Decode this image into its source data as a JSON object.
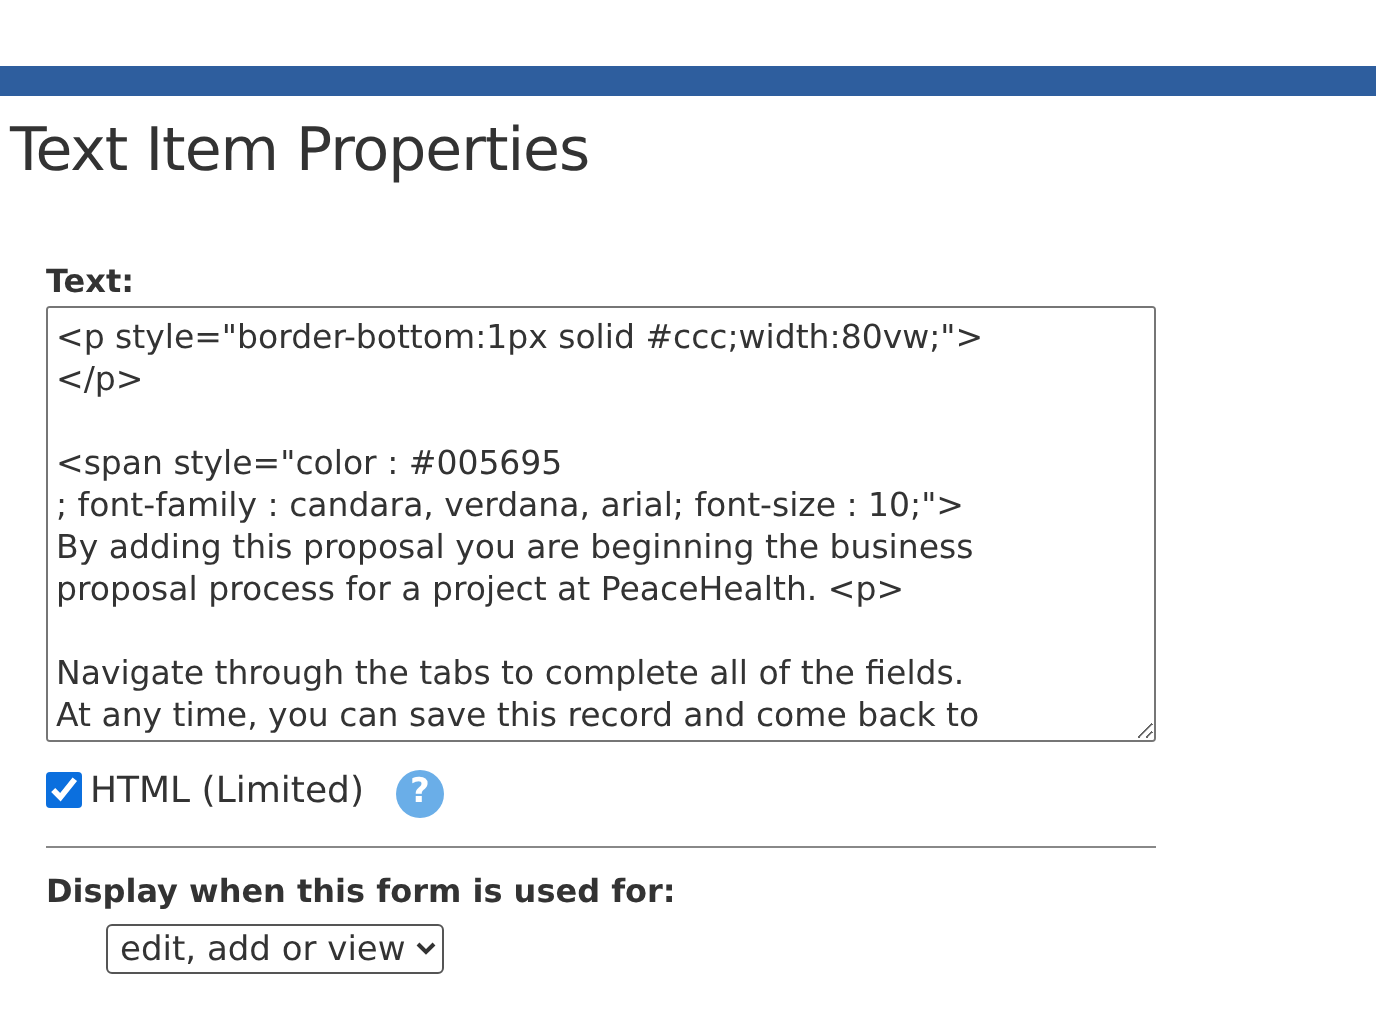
{
  "title": "Text Item Properties",
  "text_field": {
    "label": "Text:",
    "value": "<p style=\"border-bottom:1px solid #ccc;width:80vw;\">\n</p>\n\n<span style=\"color : #005695\n; font-family : candara, verdana, arial; font-size : 10;\">\nBy adding this proposal you are beginning the business\nproposal process for a project at PeaceHealth. <p>\n\nNavigate through the tabs to complete all of the fields.\nAt any time, you can save this record and come back to"
  },
  "html_checkbox": {
    "label": "HTML (Limited)",
    "checked": true,
    "help": "?"
  },
  "display": {
    "label": "Display when this form is used for:",
    "value": "edit, add or view"
  }
}
